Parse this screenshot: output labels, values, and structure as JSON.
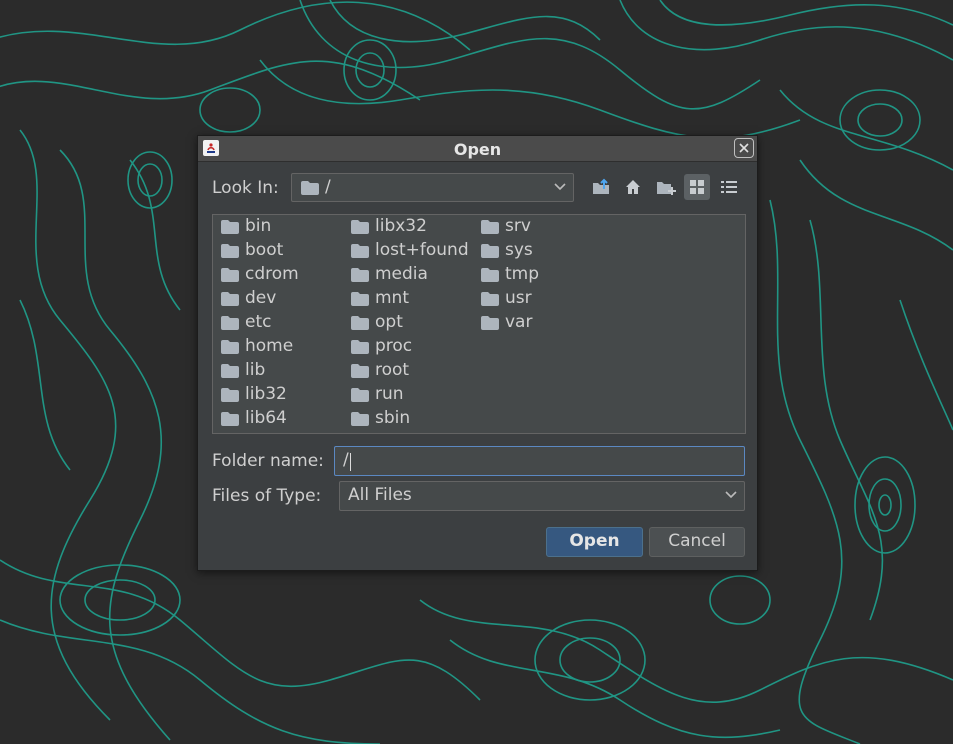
{
  "dialog": {
    "title": "Open"
  },
  "look_in": {
    "label": "Look In:",
    "value": "/"
  },
  "toolbar": {
    "icons": [
      "up-folder-icon",
      "home-icon",
      "new-folder-icon",
      "list-view-icon",
      "details-view-icon"
    ],
    "selected_view": "list"
  },
  "files": [
    "bin",
    "boot",
    "cdrom",
    "dev",
    "etc",
    "home",
    "lib",
    "lib32",
    "lib64",
    "libx32",
    "lost+found",
    "media",
    "mnt",
    "opt",
    "proc",
    "root",
    "run",
    "sbin",
    "srv",
    "sys",
    "tmp",
    "usr",
    "var"
  ],
  "folder_name": {
    "label": "Folder name:",
    "value": "/"
  },
  "files_of_type": {
    "label": "Files of Type:",
    "value": "All Files"
  },
  "buttons": {
    "open": "Open",
    "cancel": "Cancel"
  },
  "colors": {
    "background": "#2b2b2b",
    "contour": "#1fa894",
    "dialog": "#3c3f41",
    "accent": "#365880"
  }
}
